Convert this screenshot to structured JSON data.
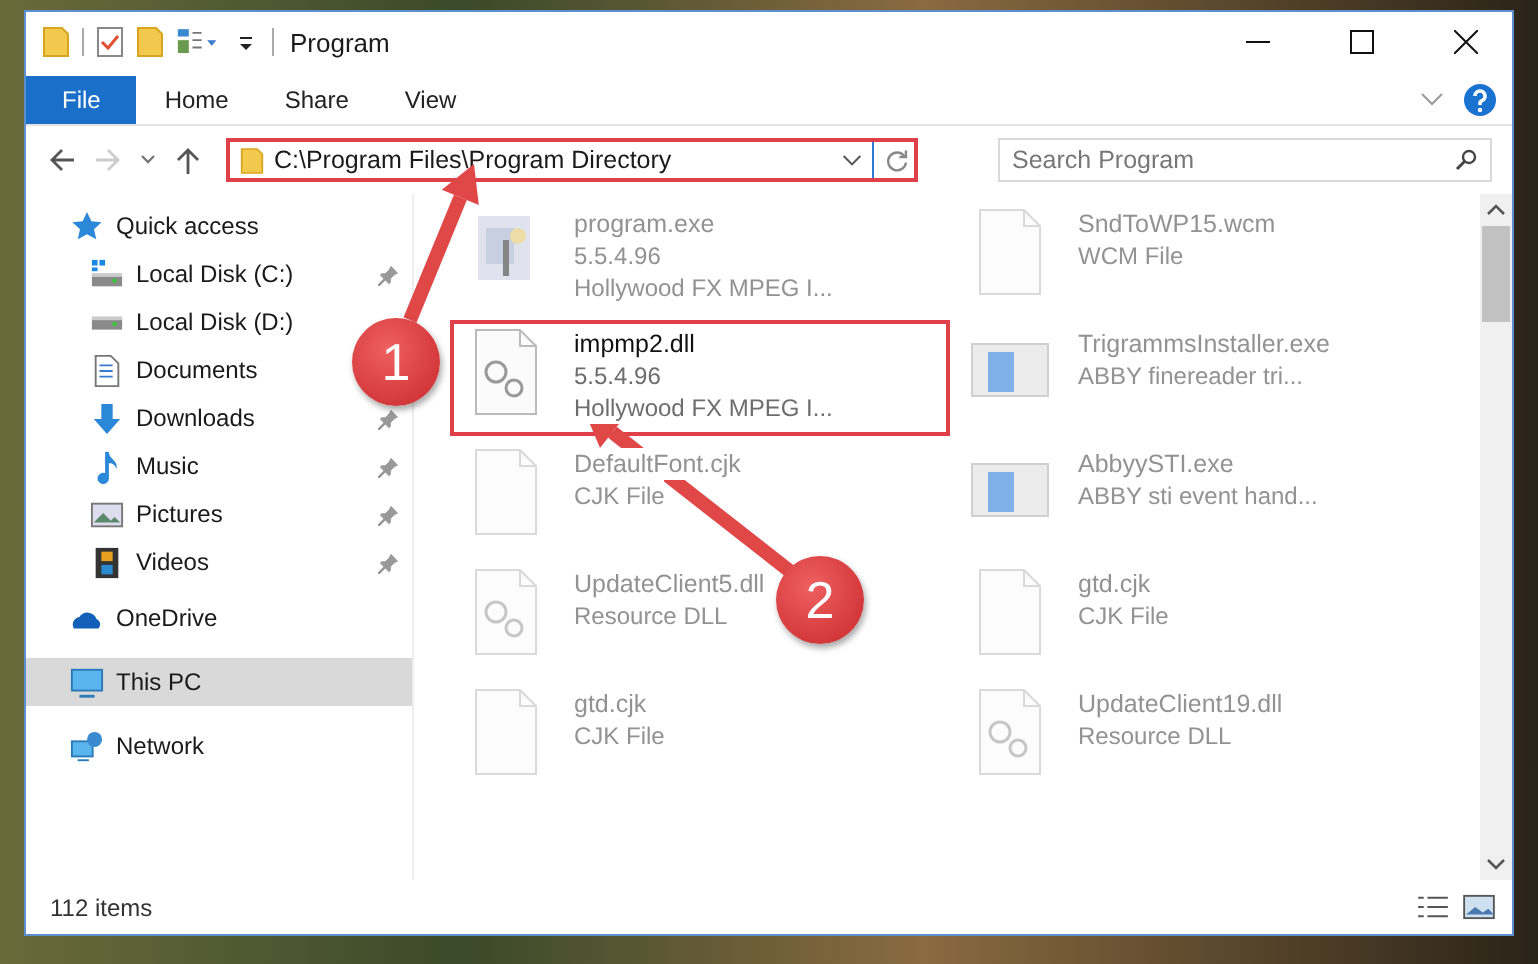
{
  "window": {
    "title": "Program"
  },
  "ribbon_tabs": [
    {
      "label": "File",
      "selected": true
    },
    {
      "label": "Home",
      "selected": false
    },
    {
      "label": "Share",
      "selected": false
    },
    {
      "label": "View",
      "selected": false
    }
  ],
  "address_bar": {
    "path": "C:\\Program Files\\Program Directory",
    "highlighted": true
  },
  "search": {
    "placeholder": "Search Program"
  },
  "sidebar": {
    "items": [
      {
        "label": "Quick access",
        "kind": "star",
        "selected": false,
        "children": [
          {
            "label": "Local Disk (C:)",
            "kind": "disk-c",
            "pinned": true,
            "selected": false
          },
          {
            "label": "Local Disk (D:)",
            "kind": "disk",
            "pinned": false,
            "selected": false
          },
          {
            "label": "Documents",
            "kind": "documents",
            "pinned": false,
            "selected": false
          },
          {
            "label": "Downloads",
            "kind": "downloads",
            "pinned": true,
            "selected": false
          },
          {
            "label": "Music",
            "kind": "music",
            "pinned": true,
            "selected": false
          },
          {
            "label": "Pictures",
            "kind": "pictures",
            "pinned": true,
            "selected": false
          },
          {
            "label": "Videos",
            "kind": "videos",
            "pinned": true,
            "selected": false
          }
        ]
      },
      {
        "label": "OneDrive",
        "kind": "cloud",
        "selected": false
      },
      {
        "label": "This PC",
        "kind": "pc",
        "selected": true
      },
      {
        "label": "Network",
        "kind": "network",
        "selected": false
      }
    ]
  },
  "files": [
    {
      "name": "program.exe",
      "kind": "exe",
      "faded": true,
      "highlighted": false,
      "details": [
        "5.5.4.96",
        "Hollywood FX MPEG I..."
      ]
    },
    {
      "name": "SndToWP15.wcm",
      "kind": "blank",
      "faded": true,
      "highlighted": false,
      "details": [
        "WCM File"
      ]
    },
    {
      "name": "impmp2.dll",
      "kind": "dll",
      "faded": false,
      "highlighted": true,
      "details": [
        "5.5.4.96",
        "Hollywood FX MPEG I..."
      ]
    },
    {
      "name": "TrigrammsInstaller.exe",
      "kind": "window",
      "faded": true,
      "highlighted": false,
      "details": [
        "ABBY finereader tri..."
      ]
    },
    {
      "name": "DefaultFont.cjk",
      "kind": "blank",
      "faded": true,
      "highlighted": false,
      "details": [
        "CJK File"
      ]
    },
    {
      "name": "AbbyySTI.exe",
      "kind": "window",
      "faded": true,
      "highlighted": false,
      "details": [
        "ABBY sti event hand..."
      ]
    },
    {
      "name": "UpdateClient5.dll",
      "kind": "dll",
      "faded": true,
      "highlighted": false,
      "details": [
        "Resource DLL"
      ]
    },
    {
      "name": "gtd.cjk",
      "kind": "blank",
      "faded": true,
      "highlighted": false,
      "details": [
        "CJK File"
      ]
    },
    {
      "name": "gtd.cjk",
      "kind": "blank",
      "faded": true,
      "highlighted": false,
      "details": [
        "CJK File"
      ]
    },
    {
      "name": "UpdateClient19.dll",
      "kind": "dll",
      "faded": true,
      "highlighted": false,
      "details": [
        "Resource DLL"
      ]
    }
  ],
  "status_bar": {
    "count": "112 items"
  },
  "callouts": [
    {
      "number": "1"
    },
    {
      "number": "2"
    }
  ]
}
